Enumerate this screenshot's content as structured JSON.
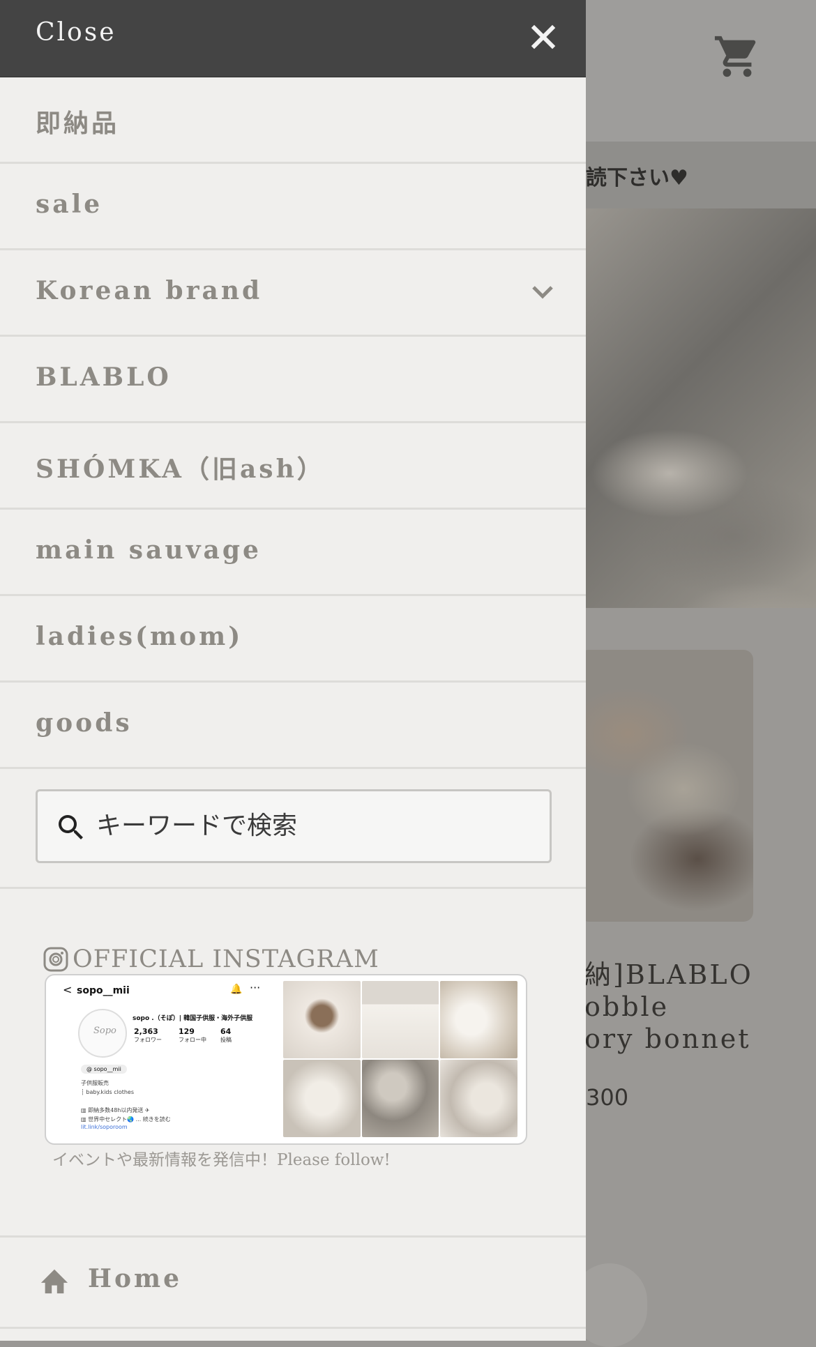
{
  "drawer": {
    "close_label": "Close",
    "menu_items": [
      {
        "label": "即納品"
      },
      {
        "label": "sale"
      },
      {
        "label": "Korean brand",
        "expandable": true
      },
      {
        "label": "BLABLO"
      },
      {
        "label": "SHÓMKA（旧ash）"
      },
      {
        "label": "main sauvage"
      },
      {
        "label": "ladies(mom)"
      },
      {
        "label": "goods"
      }
    ],
    "search": {
      "placeholder": "キーワードで検索",
      "value": ""
    },
    "instagram": {
      "title": "OFFICIAL INSTAGRAM",
      "caption": "イベントや最新情報を発信中！Please follow!",
      "preview": {
        "back": "<",
        "handle": "sopo__mii",
        "bell": "🔔",
        "more": "···",
        "avatar_text": "Sopo",
        "name": "sopo .（そぽ）| 韓国子供服・海外子供服",
        "followers": "2,363",
        "followers_label": "フォロワー",
        "following": "129",
        "following_label": "フォロー中",
        "posts": "64",
        "posts_label": "投稿",
        "threads": "@ sopo__mii",
        "bio": "子供服販売\n┆ baby.kids clothes\n\n▥ 即納多数48h以内発送 ✈\n▥ 世界中セレクト🌏 ... 続きを読む",
        "link": "lit.link/soporoom"
      }
    },
    "home_label": "Home"
  },
  "background": {
    "banner_text": "読下さい♥",
    "product_title": "納]BLABLO\nobble\nory bonnet",
    "product_price": "300"
  },
  "colors": {
    "drawer_bg": "#f0efed",
    "header_bg": "#444444",
    "menu_text": "#8d8a84",
    "divider": "#dddcd9"
  }
}
